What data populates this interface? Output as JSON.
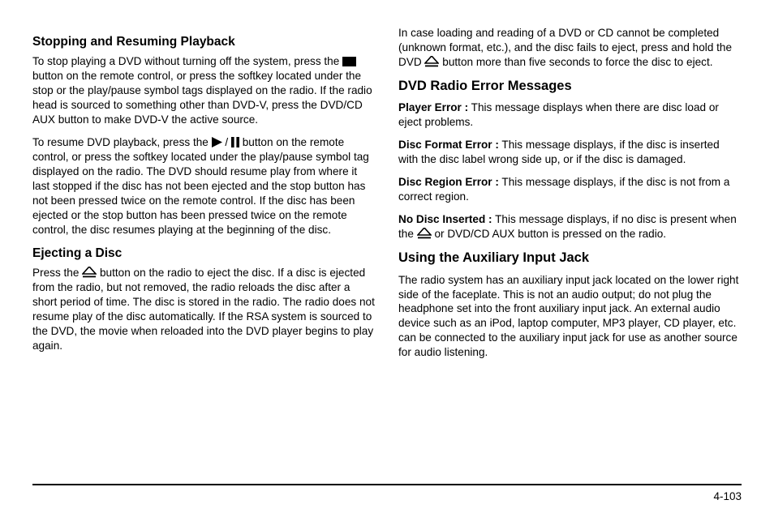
{
  "left": {
    "h1": "Stopping and Resuming Playback",
    "p1a": "To stop playing a DVD without turning off the system, press the ",
    "p1b": " button on the remote control, or press the softkey located under the stop or the play/pause symbol tags displayed on the radio. If the radio head is sourced to something other than DVD-V, press the DVD/CD AUX button to make DVD-V the active source.",
    "p2a": "To resume DVD playback, press the ",
    "p2b": " button on the remote control, or press the softkey located under the play/pause symbol tag displayed on the radio. The DVD should resume play from where it last stopped if the disc has not been ejected and the stop button has not been pressed twice on the remote control. If the disc has been ejected or the stop button has been pressed twice on the remote control, the disc resumes playing at the beginning of the disc.",
    "h2": "Ejecting a Disc",
    "p3a": "Press the ",
    "p3b": " button on the radio to eject the disc. If a disc is ejected from the radio, but not removed, the radio reloads the disc after a short period of time. The disc is stored in the radio. The radio does not resume play of the disc automatically. If the RSA system is sourced to the DVD, the movie when reloaded into the DVD player begins to play again."
  },
  "right": {
    "p0a": "In case loading and reading of a DVD or CD cannot be completed (unknown format, etc.), and the disc fails to eject, press and hold the DVD ",
    "p0b": " button more than five seconds to force the disc to eject.",
    "h1": "DVD Radio Error Messages",
    "e1l": "Player Error :",
    "e1t": " This message displays when there are disc load or eject problems.",
    "e2l": "Disc Format Error :",
    "e2t": " This message displays, if the disc is inserted with the disc label wrong side up, or if the disc is damaged.",
    "e3l": "Disc Region Error :",
    "e3t": " This message displays, if the disc is not from a correct region.",
    "e4l": "No Disc Inserted :",
    "e4a": " This message displays, if no disc is present when the ",
    "e4b": " or DVD/CD AUX button is pressed on the radio.",
    "h2": "Using the Auxiliary Input Jack",
    "p5": "The radio system has an auxiliary input jack located on the lower right side of the faceplate. This is not an audio output; do not plug the headphone set into the front auxiliary input jack. An external audio device such as an iPod, laptop computer, MP3 player, CD player, etc. can be connected to the auxiliary input jack for use as another source for audio listening."
  },
  "slash": " / ",
  "pageNumber": "4-103"
}
